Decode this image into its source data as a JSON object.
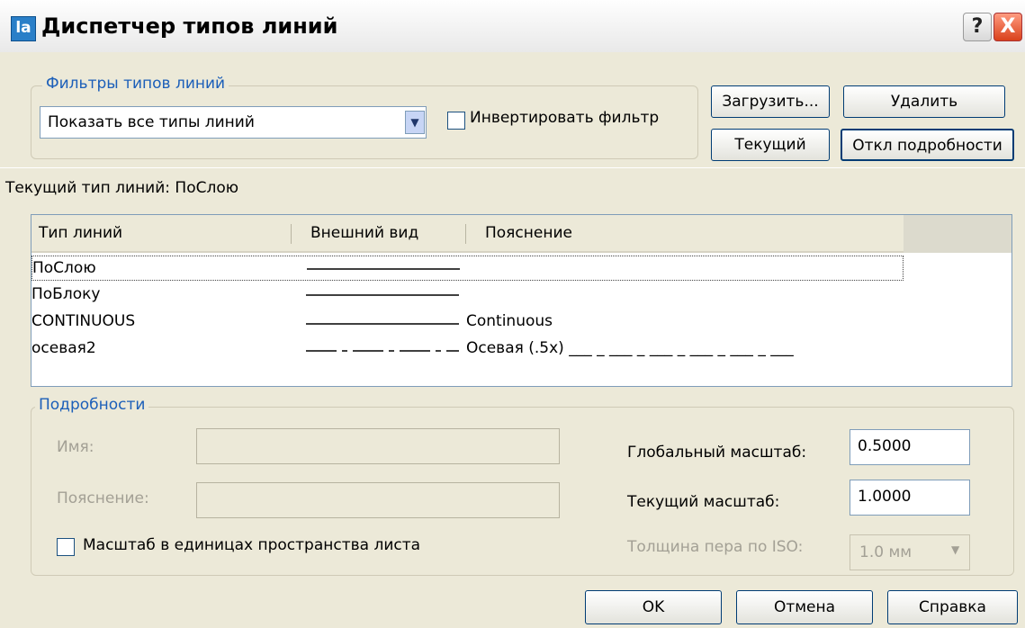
{
  "window": {
    "title": "Диспетчер типов линий",
    "help_glyph": "?",
    "close_glyph": "X",
    "icon_letters": "la"
  },
  "filters": {
    "legend": "Фильтры типов линий",
    "selected": "Показать все типы линий",
    "invert_label": "Инвертировать фильтр"
  },
  "buttons": {
    "load": "Загрузить...",
    "delete": "Удалить",
    "current": "Текущий",
    "details": "Откл подробности",
    "ok": "OK",
    "cancel": "Отмена",
    "help": "Справка"
  },
  "status": {
    "current_linetype": "Текущий тип линий:  ПоСлою"
  },
  "list": {
    "columns": [
      "Тип линий",
      "Внешний вид",
      "Пояснение"
    ],
    "rows": [
      {
        "name": "ПоСлою",
        "description": "",
        "pattern": "solid"
      },
      {
        "name": "ПоБлоку",
        "description": "",
        "pattern": "solid"
      },
      {
        "name": "CONTINUOUS",
        "description": "Continuous",
        "pattern": "solid"
      },
      {
        "name": "осевая2",
        "description": "Осевая (.5x) ___ _ ___ _ ___ _ ___ _ ___ _ ___",
        "pattern": "center"
      }
    ]
  },
  "details": {
    "legend": "Подробности",
    "name_label": "Имя:",
    "desc_label": "Пояснение:",
    "paper_space_label": "Масштаб в единицах пространства листа",
    "global_scale_label": "Глобальный масштаб:",
    "global_scale_value": "0.5000",
    "current_scale_label": "Текущий масштаб:",
    "current_scale_value": "1.0000",
    "iso_pen_label": "Толщина пера по ISO:",
    "iso_pen_value": "1.0 мм"
  },
  "icons": {
    "dropdown": "chevron-down-icon",
    "app": "linetype-manager-icon"
  },
  "colors": {
    "dialog_bg": "#ece9d8",
    "accent": "#1c5fb9",
    "close": "#d9411b"
  }
}
